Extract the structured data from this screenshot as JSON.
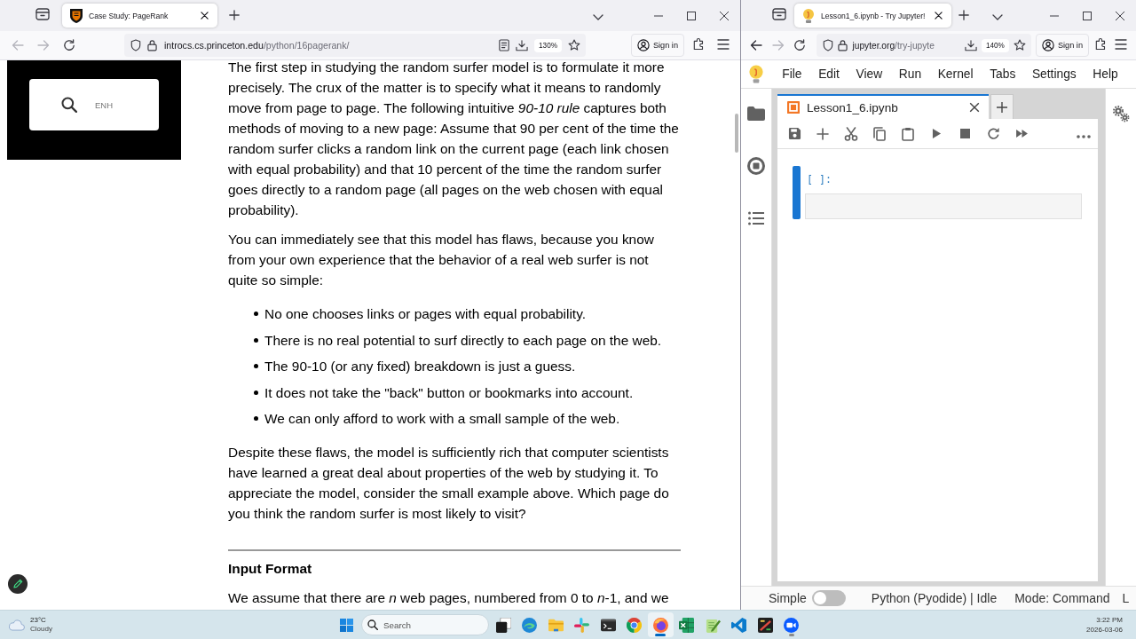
{
  "left_browser": {
    "tabs": [
      {
        "title": "Case Study: PageRank",
        "selected": true
      }
    ],
    "nav": {
      "back_disabled": true,
      "forward_disabled": true
    },
    "address": {
      "host": "introcs.cs.princeton.edu",
      "path": "/python/16pagerank/"
    },
    "reader_view": true,
    "zoom": "130%",
    "sign_in": "Sign in"
  },
  "article": {
    "search_banner": {
      "text": "ENH"
    },
    "blocks": [
      {
        "kind": "paragraph",
        "text": "The first step in studying the random surfer model is to formulate it more precisely. The crux of the matter is to specify what it means to randomly move from page to page. The following intuitive *90-10 rule* captures both methods of moving to a new page: Assume that 90 per cent of the time the random surfer clicks a random link on the current page (each link chosen with equal probability) and that 10 percent of the time the random surfer goes directly to a random page (all pages on the web chosen with equal probability)."
      },
      {
        "kind": "paragraph",
        "text": "You can immediately see that this model has flaws, because you know from your own experience that the behavior of a real web surfer is not quite so simple:"
      },
      {
        "kind": "list",
        "items": [
          "No one chooses links or pages with equal probability.",
          "There is no real potential to surf directly to each page on the web.",
          "The 90-10 (or any fixed) breakdown is just a guess.",
          "It does not take the \"back\" button or bookmarks into account.",
          "We can only afford to work with a small sample of the web."
        ]
      },
      {
        "kind": "paragraph",
        "text": "Despite these flaws, the model is sufficiently rich that computer scientists have learned a great deal about properties of the web by studying it. To appreciate the model, consider the small example above. Which page do you think the random surfer is most likely to visit?"
      },
      {
        "kind": "rule"
      },
      {
        "kind": "heading",
        "text": "Input Format"
      },
      {
        "kind": "paragraph",
        "text": "We assume that there are *n* web pages, numbered from 0 to *n*-1, and we"
      }
    ]
  },
  "right_browser": {
    "tabs": [
      {
        "title": "Lesson1_6.ipynb - Try Jupyter!",
        "selected": true
      }
    ],
    "nav": {
      "back_disabled": false,
      "forward_disabled": true
    },
    "address": {
      "host": "jupyter.org",
      "path": "/try-jupyte"
    },
    "reader_view": false,
    "zoom": "140%",
    "sign_in": "Sign in"
  },
  "jupyter": {
    "menu": [
      "File",
      "Edit",
      "View",
      "Run",
      "Kernel",
      "Tabs",
      "Settings",
      "Help"
    ],
    "tabs": [
      {
        "title": "Lesson1_6.ipynb",
        "selected": true
      }
    ],
    "cells": [
      {
        "prompt": "[ ]:",
        "selected": true
      }
    ],
    "status_bar": {
      "label": "Simple",
      "simple_mode": false,
      "kernel": "Python (Pyodide) | Idle",
      "mode": "Mode: Command",
      "field_4": "L"
    }
  },
  "taskbar": {
    "weather": {
      "temperature": "23°C",
      "condition": "Cloudy"
    },
    "search": {
      "placeholder": "Search"
    },
    "apps": [
      {
        "kind": "task-view",
        "running": false,
        "focused": false
      },
      {
        "kind": "browser-swirl",
        "running": false,
        "focused": false
      },
      {
        "kind": "folder",
        "running": false,
        "focused": false
      },
      {
        "kind": "pinwheel",
        "running": false,
        "focused": false
      },
      {
        "kind": "terminal",
        "running": false,
        "focused": false
      },
      {
        "kind": "browser-ring",
        "running": false,
        "focused": false
      },
      {
        "kind": "browser-flame",
        "running": true,
        "focused": true
      },
      {
        "kind": "spreadsheet",
        "running": false,
        "focused": false
      },
      {
        "kind": "notepad",
        "running": false,
        "focused": false
      },
      {
        "kind": "code-editor",
        "running": false,
        "focused": false
      },
      {
        "kind": "dark-window",
        "running": false,
        "focused": false
      },
      {
        "kind": "video-call",
        "running": true,
        "focused": false
      }
    ],
    "time": "3:22 PM",
    "date": "2026-03-06"
  }
}
